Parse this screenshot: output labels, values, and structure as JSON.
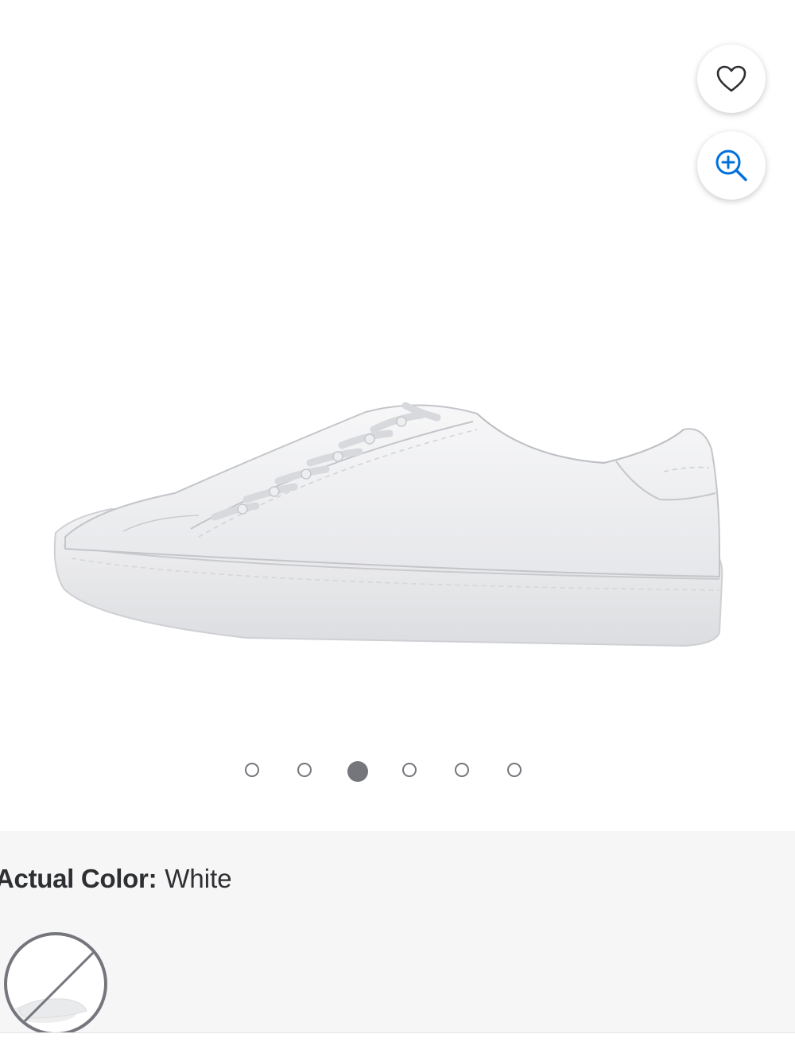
{
  "gallery": {
    "image_alt": "White leather low-top lace-up sneaker, side view",
    "favorite_icon": "heart-icon",
    "zoom_icon": "zoom-in-icon",
    "slide_count": 6,
    "active_slide": 3,
    "colors": {
      "accent": "#0071dc",
      "icon_dark": "#2e2f32",
      "dot": "#74767c"
    }
  },
  "variant": {
    "label": "Actual Color:",
    "value": "White",
    "swatch_state": "unavailable",
    "panel_bg": "#f6f6f6"
  }
}
